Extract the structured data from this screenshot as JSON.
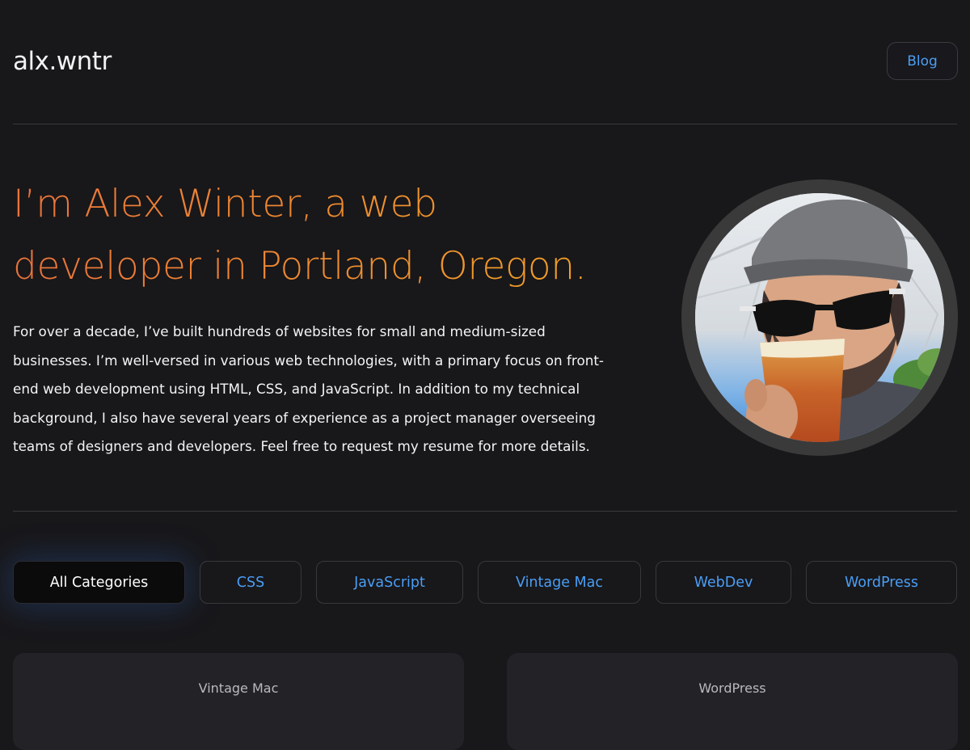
{
  "header": {
    "site_title": "alx.wntr",
    "nav": {
      "blog_label": "Blog"
    }
  },
  "hero": {
    "headline_line1": "I’m Alex Winter, a web",
    "headline_line2": "developer in Portland, Oregon.",
    "bio_lines": [
      "For over a decade, I’ve built hundreds of websites for small and medium-sized",
      "businesses. I’m well-versed in various web technologies, with a primary focus on front-",
      "end web development using HTML, CSS, and JavaScript. In addition to my technical",
      "background, I also have several years of experience as a project manager overseeing",
      "teams of designers and developers. Feel free to request my resume for more details."
    ]
  },
  "filters": {
    "items": [
      {
        "label": "All Categories",
        "active": true
      },
      {
        "label": "CSS",
        "active": false
      },
      {
        "label": "JavaScript",
        "active": false
      },
      {
        "label": "Vintage Mac",
        "active": false
      },
      {
        "label": "WebDev",
        "active": false
      },
      {
        "label": "WordPress",
        "active": false
      }
    ]
  },
  "posts": [
    {
      "category": "Vintage Mac"
    },
    {
      "category": "WordPress"
    }
  ],
  "colors": {
    "background": "#18171a",
    "accent_orange_start": "#e8733a",
    "accent_orange_end": "#f2a526",
    "link_blue": "#4a9ef5",
    "card_background": "#232227"
  }
}
